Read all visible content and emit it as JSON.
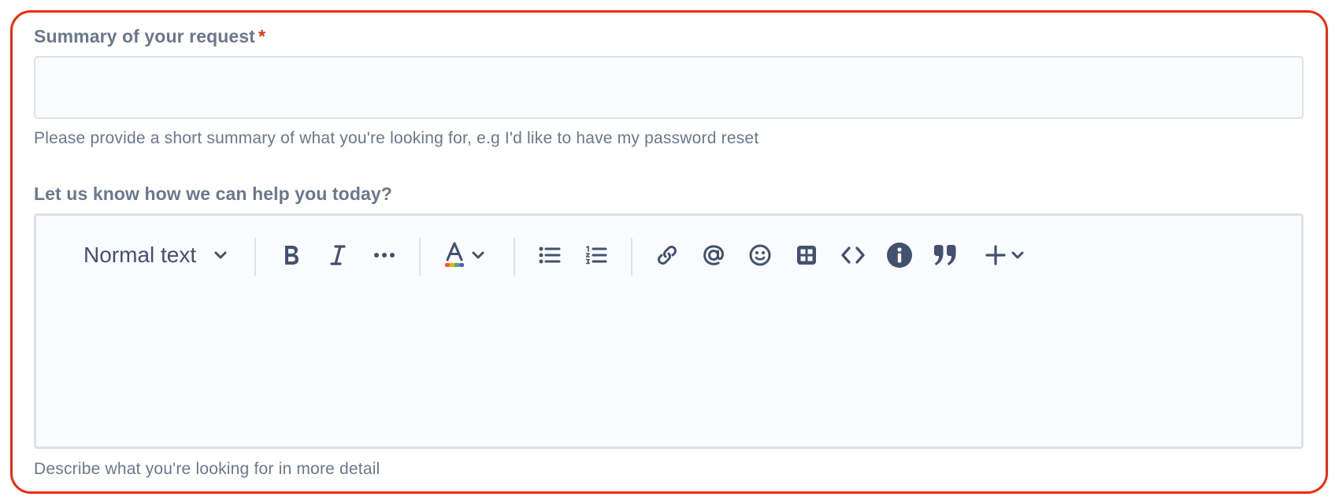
{
  "summary_field": {
    "label": "Summary of your request",
    "required_mark": "*",
    "value": "",
    "placeholder": "",
    "help": "Please provide a short summary of what you're looking for, e.g I'd like to have my password reset"
  },
  "description_field": {
    "label": "Let us know how we can help you today?",
    "help": "Describe what you're looking for in more detail",
    "text_style": "Normal text",
    "toolbar_icons": [
      "bold-icon",
      "italic-icon",
      "more-formatting-icon",
      "text-color-icon",
      "bullet-list-icon",
      "numbered-list-icon",
      "link-icon",
      "mention-icon",
      "emoji-icon",
      "table-icon",
      "code-icon",
      "info-panel-icon",
      "quote-icon",
      "insert-plus-icon"
    ]
  },
  "colors": {
    "frame_border": "#f2290e",
    "label": "#6b778c",
    "required": "#de350b",
    "icon": "#42526e",
    "field_bg": "#fafbfc",
    "field_border": "#dfe1e6"
  }
}
